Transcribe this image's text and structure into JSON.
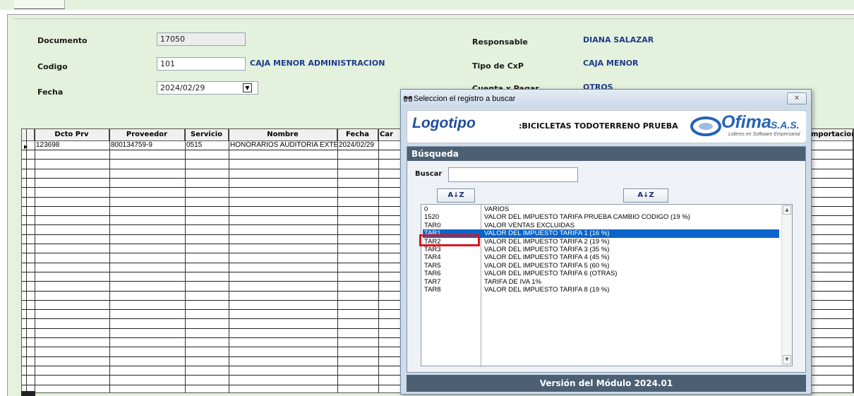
{
  "form": {
    "documento_label": "Documento",
    "documento_value": "17050",
    "codigo_label": "Codigo",
    "codigo_value": "101",
    "codigo_desc": "CAJA MENOR ADMINISTRACION",
    "fecha_label": "Fecha",
    "fecha_value": "2024/02/29",
    "responsable_label": "Responsable",
    "responsable_value": "DIANA SALAZAR",
    "tipo_cxp_label": "Tipo de CxP",
    "tipo_cxp_value": "CAJA MENOR",
    "cuenta_label": "Cuenta x Pagar",
    "cuenta_value": "OTROS"
  },
  "grid": {
    "headers": [
      "Dcto Prv",
      "Proveedor",
      "Servicio",
      "Nombre",
      "Fecha",
      "Car",
      "mportacion"
    ],
    "rows": [
      [
        "123698",
        "800134759-9",
        "0515",
        "HONORARIOS AUDITORIA EXTERNA",
        "2024/02/29"
      ]
    ]
  },
  "dialog": {
    "title": "Seleccion el registro a buscar",
    "close_glyph": "✕",
    "logotipo": "Logotipo",
    "company": ":BICICLETAS TODOTERRENO PRUEBA",
    "ofima_brand": "Ofima",
    "ofima_sas": "S.A.S.",
    "ofima_tagline": "Lideres en Software Empresarial",
    "section_title": "Búsqueda",
    "buscar_label": "Buscar",
    "buscar_value": "",
    "sort_glyph": "A↓Z",
    "items": [
      {
        "code": "0",
        "desc": "VARIOS"
      },
      {
        "code": "1520",
        "desc": "VALOR DEL IMPUESTO TARIFA PRUEBA CAMBIO CODIGO (19 %)"
      },
      {
        "code": "TAR0",
        "desc": "VALOR VENTAS EXCLUIDAS"
      },
      {
        "code": "TAR1",
        "desc": "VALOR DEL IMPUESTO TARIFA 1 (16 %)",
        "selected": true
      },
      {
        "code": "TAR2",
        "desc": "VALOR DEL IMPUESTO TARIFA 2 (19 %)"
      },
      {
        "code": "TAR3",
        "desc": "VALOR DEL IMPUESTO TARIFA 3 (35 %)"
      },
      {
        "code": "TAR4",
        "desc": "VALOR DEL IMPUESTO TARIFA 4 (45 %)"
      },
      {
        "code": "TAR5",
        "desc": "VALOR DEL IMPUESTO TARIFA 5 (60 %)"
      },
      {
        "code": "TAR6",
        "desc": "VALOR DEL IMPUESTO TARIFA 6 (OTRAS)"
      },
      {
        "code": "TAR7",
        "desc": "TARIFA DE IVA 1%"
      },
      {
        "code": "TAR8",
        "desc": "VALOR DEL IMPUESTO TARIFA 8 (19 %)"
      }
    ],
    "version": "Versión del Módulo 2024.01"
  },
  "colors": {
    "form_bg": "#e4f1dc",
    "label_blue": "#1d3b8a",
    "selection": "#0a64c9",
    "highlight_box": "#e0141c",
    "header_bar": "#4c5f73"
  },
  "icons": [
    "binoculars-icon",
    "close-icon",
    "dropdown-arrow-icon",
    "sort-az-icon",
    "scroll-up-icon",
    "scroll-down-icon",
    "row-pointer-icon"
  ]
}
